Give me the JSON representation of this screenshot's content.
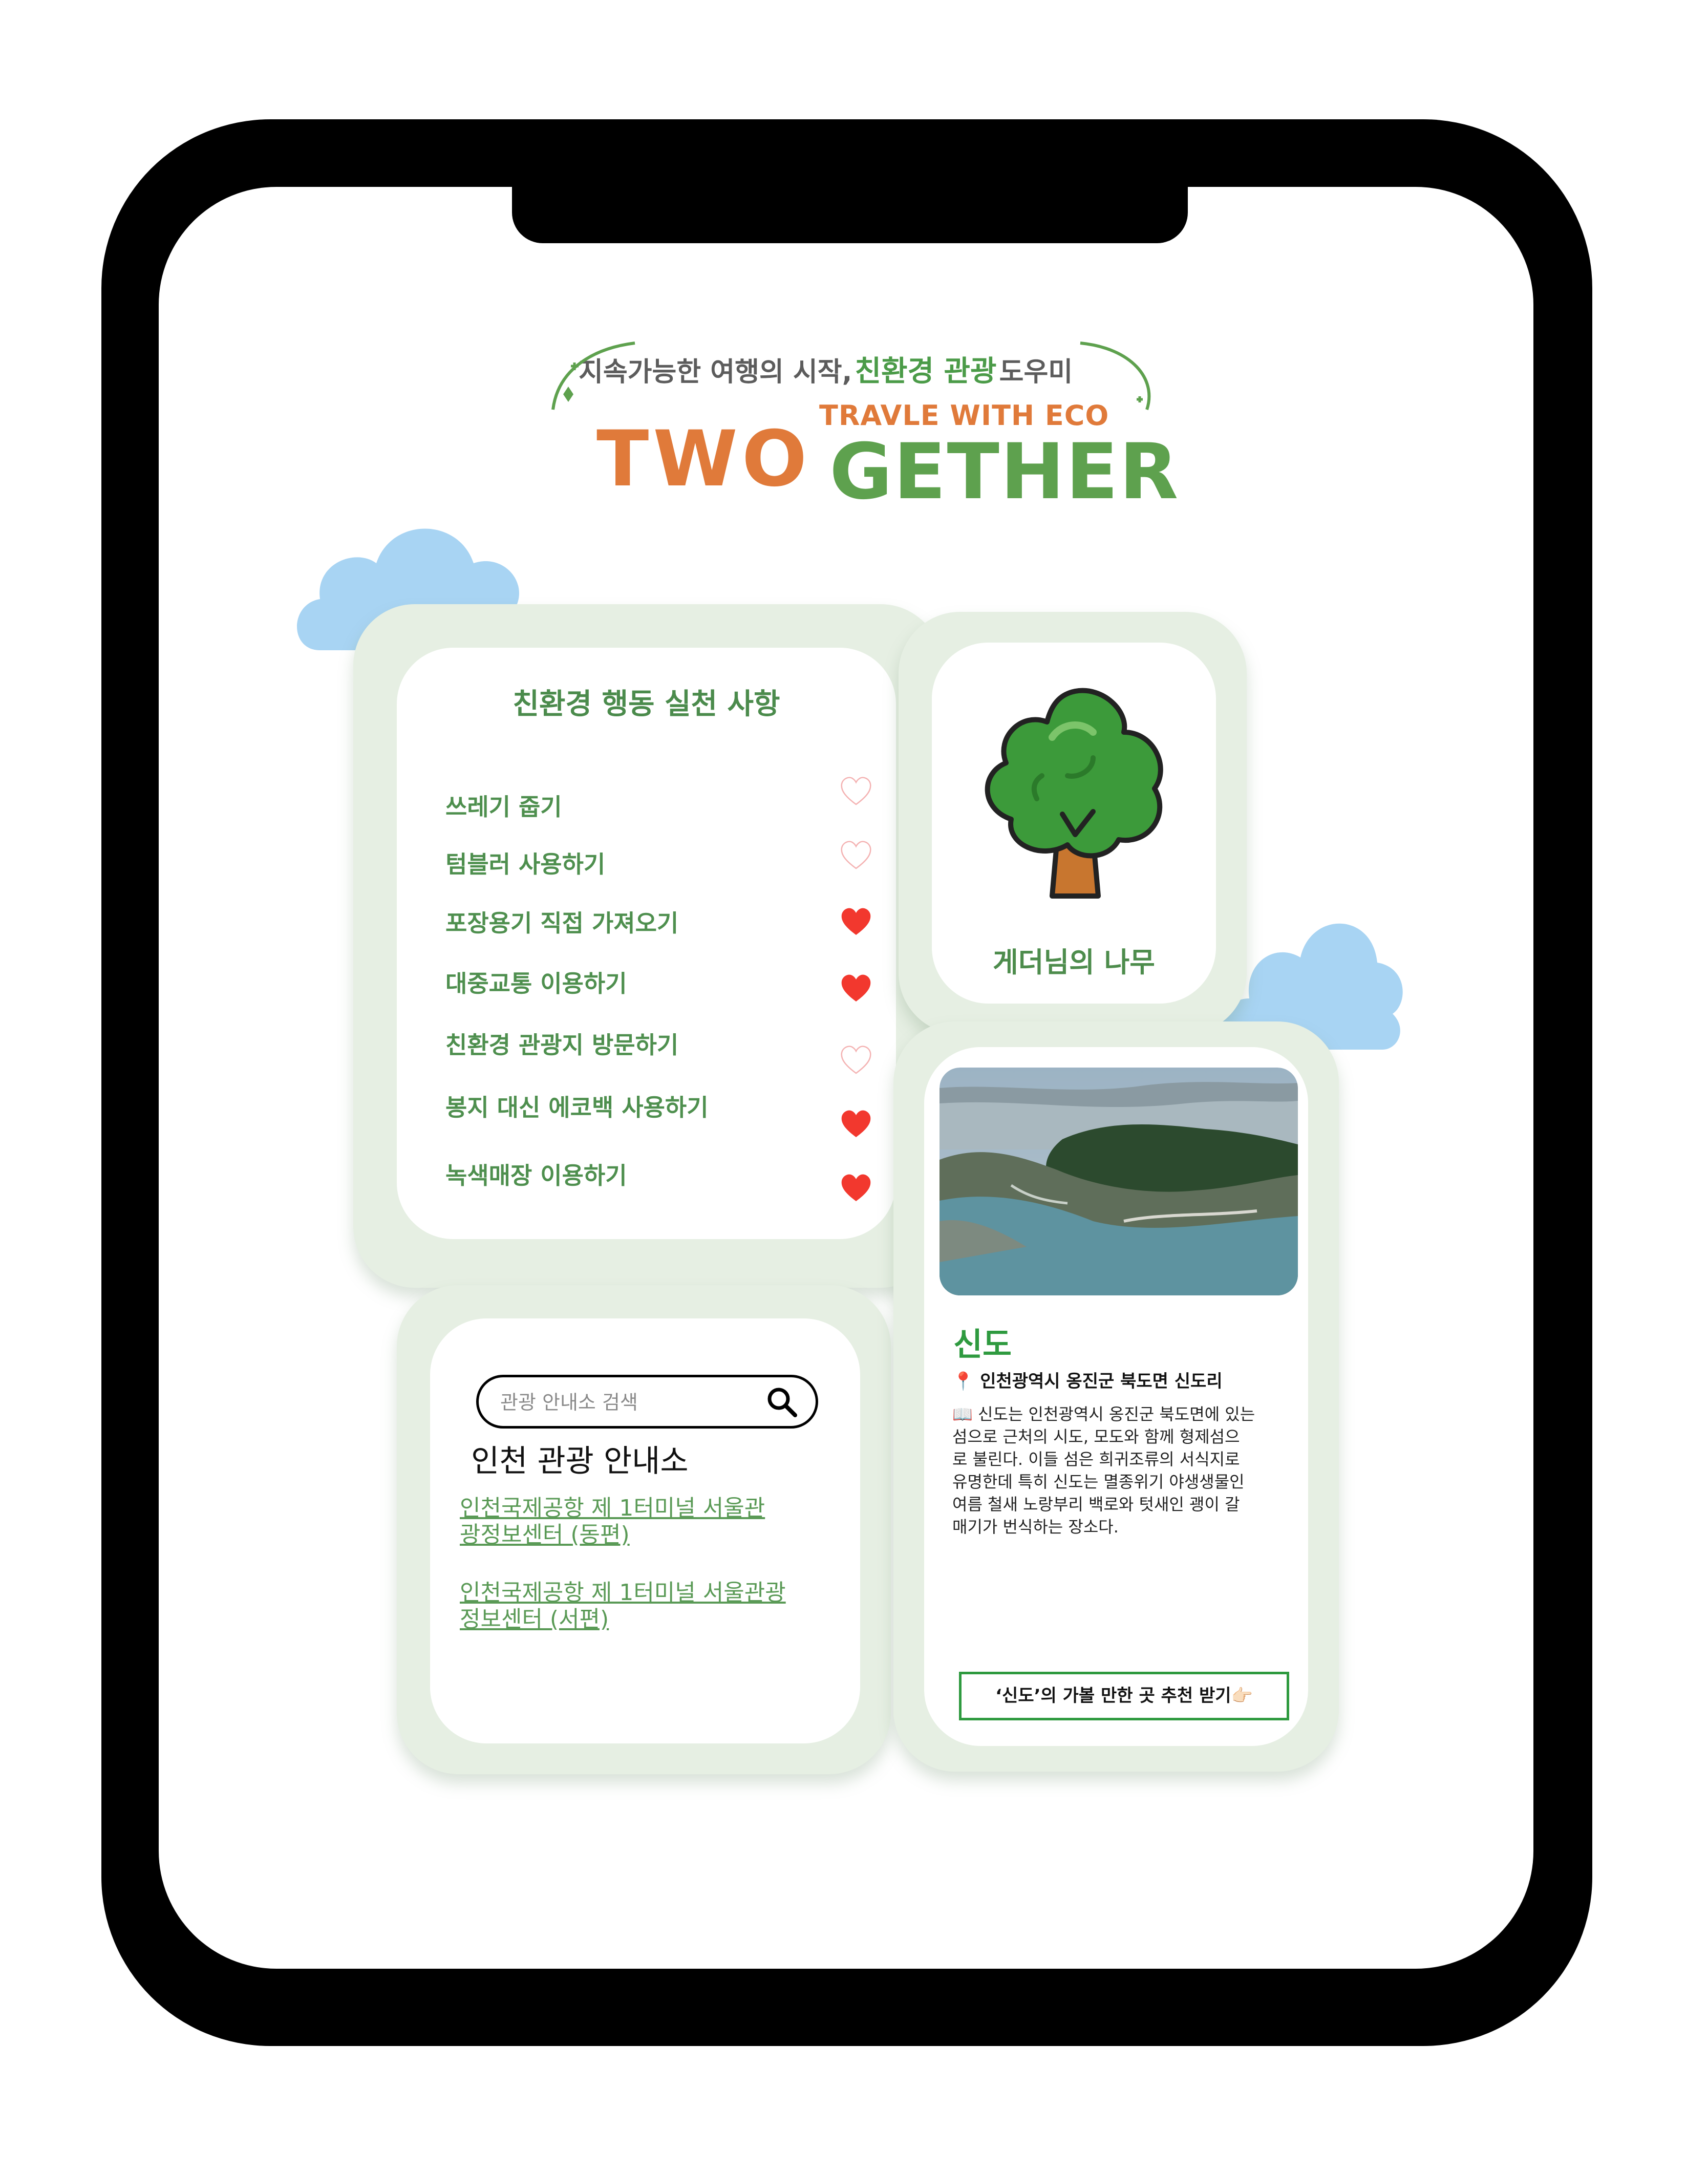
{
  "header": {
    "tagline_part1": "지속가능한 여행의 시작,",
    "tagline_highlight": "친환경 관광",
    "tagline_part2": "도우미",
    "subtitle": "TRAVLE WITH ECO",
    "logo_left": "TWO",
    "logo_right": "GETHER"
  },
  "eco_actions": {
    "title": "친환경 행동 실천 사항",
    "items": [
      {
        "label": "쓰레기 줍기",
        "liked": false
      },
      {
        "label": "텀블러 사용하기",
        "liked": false
      },
      {
        "label": "포장용기 직접 가져오기",
        "liked": true
      },
      {
        "label": "대중교통 이용하기",
        "liked": true
      },
      {
        "label": "친환경 관광지 방문하기",
        "liked": false
      },
      {
        "label": "봉지 대신 에코백 사용하기",
        "liked": true
      },
      {
        "label": "녹색매장 이용하기",
        "liked": true
      }
    ]
  },
  "tree": {
    "icon": "tree-icon",
    "label": "게더님의 나무"
  },
  "tourist_info": {
    "search_placeholder": "관광 안내소 검색",
    "title": "인천 관광 안내소",
    "links": [
      {
        "line1": "인천국제공항 제 1터미널 서울관",
        "line2": "광정보센터 (동편)"
      },
      {
        "line1": "인천국제공항 제 1터미널 서울관광",
        "line2": "정보센터 (서편)"
      }
    ]
  },
  "place": {
    "name": "신도",
    "location_icon": "📍",
    "address": "인천광역시 옹진군 북도면 신도리",
    "desc_icon": "📖",
    "description_lines": [
      "신도는 인천광역시 옹진군 북도면에 있는",
      "섬으로 근처의 시도, 모도와 함께 형제섬으",
      "로 불린다. 이들 섬은 희귀조류의 서식지로",
      "유명한데 특히 신도는 멸종위기 야생생물인",
      "여름 철새 노랑부리 백로와 텃새인 괭이 갈",
      "매기가 번식하는 장소다."
    ],
    "button_label": "‘신도’의 가볼 만한 곳 추천 받기👉🏻"
  },
  "colors": {
    "accent_green": "#4b8b4c",
    "card_bg": "#e6efe3",
    "heart_red": "#f2382e",
    "logo_orange": "#e07a3a",
    "cloud": "#a8d4f3"
  }
}
